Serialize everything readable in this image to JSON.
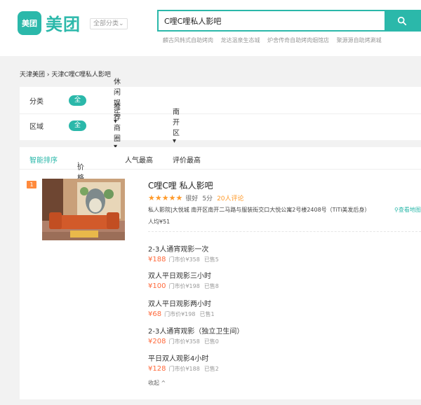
{
  "header": {
    "logo_box": "美团",
    "logo_text": "美团",
    "category_dropdown": "全部分类",
    "search_value": "C哩C哩私人影吧",
    "hot_searches": [
      "麟古风韩式自助烤肉",
      "龙达温泉生态城",
      "炉舍传奇自助烤肉烟馆店",
      "聚源源自助烤涮城"
    ]
  },
  "breadcrumb": "天津美团 › 天津C哩C哩私人影吧",
  "filters": {
    "category_label": "分类",
    "category_all": "全部",
    "category_option": "休闲娱乐",
    "area_label": "区域",
    "area_all": "全部",
    "area_option1": "推荐商圈",
    "area_option2": "南开区"
  },
  "sort": {
    "smart": "智能排序",
    "price": "价格排序",
    "popular": "人气最高",
    "rated": "评价最高"
  },
  "result": {
    "rank": "1",
    "title": "C哩C哩 私人影吧",
    "stars": "★★★★★",
    "grade": "很好",
    "score": "5分",
    "reviews": "20人评论",
    "address": "私人影院|大悦城   南开区南开二马路与服装街交口大悦公寓2号楼2408号（TiTi美发后身）",
    "map_link": "查看地图",
    "avg_price": "人均¥51",
    "deals": [
      {
        "title": "2-3人通宵观影一次",
        "price": "¥188",
        "market": "门市价¥358",
        "sold": "已售5"
      },
      {
        "title": "双人平日观影三小时",
        "price": "¥100",
        "market": "门市价¥198",
        "sold": "已售8"
      },
      {
        "title": "双人平日观影两小时",
        "price": "¥68",
        "market": "门市价¥198",
        "sold": "已售1"
      },
      {
        "title": "2-3人通宵观影（独立卫生间）",
        "price": "¥208",
        "market": "门市价¥358",
        "sold": "已售0"
      },
      {
        "title": "平日双人观影4小时",
        "price": "¥128",
        "market": "门市价¥188",
        "sold": "已售2"
      }
    ],
    "collapse": "收起 ^"
  },
  "colors": {
    "accent": "#2bb8aa",
    "price": "#ff6a3c",
    "star": "#ff9a2a"
  }
}
